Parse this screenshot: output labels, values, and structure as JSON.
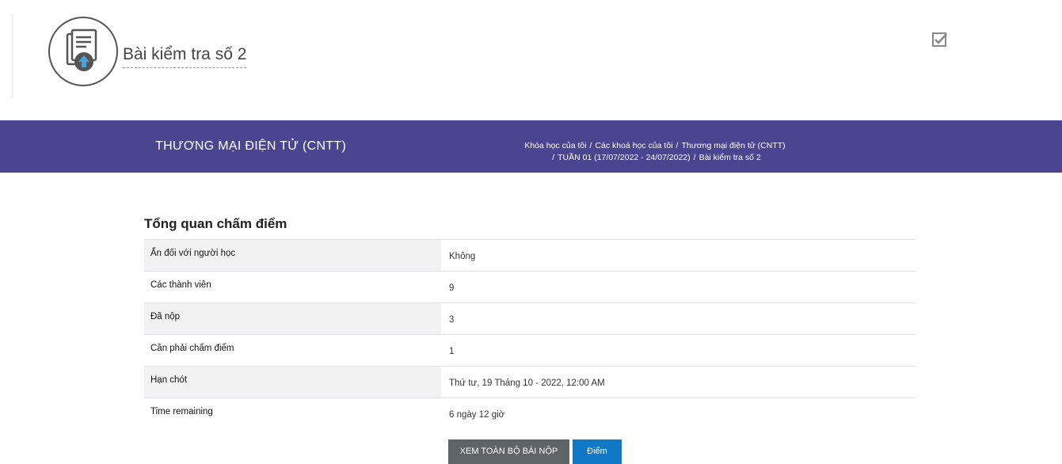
{
  "header": {
    "title": "Bài kiểm tra số 2",
    "activity_icon": "assignment-icon",
    "completion_icon": "checkbox-checked-icon"
  },
  "banner": {
    "course_name": "THƯƠNG MẠI ĐIỆN TỬ (CNTT)",
    "breadcrumb": [
      "Khóa học của tôi",
      "Các khoá học của tôi",
      "Thương mại điện tử (CNTT)",
      "TUẦN 01 (17/07/2022 - 24/07/2022)",
      "Bài kiểm tra số 2"
    ],
    "separator": "/",
    "color": "#4a4591"
  },
  "summary": {
    "heading": "Tổng quan chấm điểm",
    "rows": [
      {
        "label": "Ẩn đối với người học",
        "value": "Không"
      },
      {
        "label": "Các thành viên",
        "value": "9"
      },
      {
        "label": "Đã nộp",
        "value": "3"
      },
      {
        "label": "Cần phải chấm điểm",
        "value": "1"
      },
      {
        "label": "Hạn chót",
        "value": "Thứ tư, 19 Tháng 10 - 2022, 12:00 AM"
      },
      {
        "label": "Time remaining",
        "value": "6 ngày 12 giờ"
      }
    ]
  },
  "buttons": {
    "view_all": "XEM TOÀN BỘ BÀI NỘP",
    "grade": "Điểm"
  }
}
